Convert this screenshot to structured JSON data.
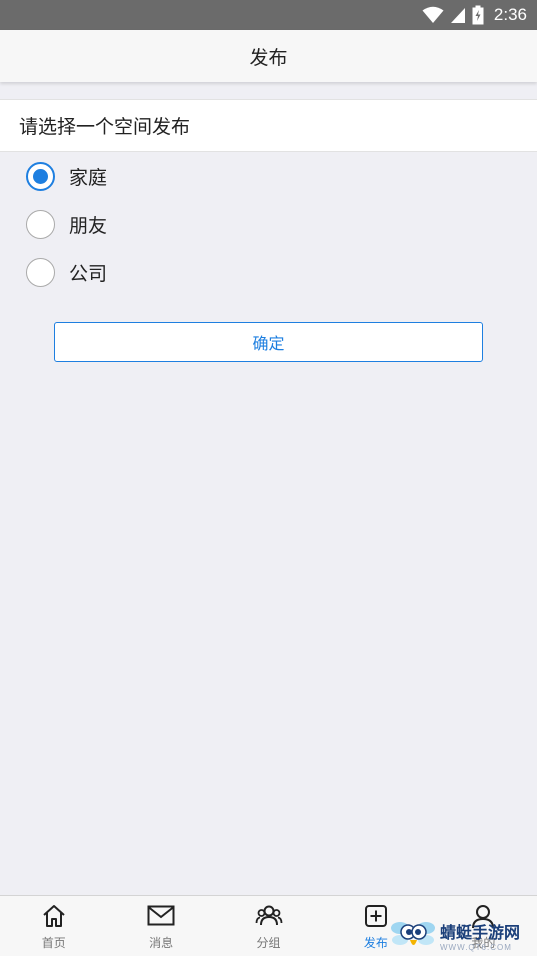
{
  "status_bar": {
    "time": "2:36"
  },
  "nav": {
    "title": "发布"
  },
  "section": {
    "header": "请选择一个空间发布"
  },
  "options": [
    {
      "label": "家庭",
      "selected": true
    },
    {
      "label": "朋友",
      "selected": false
    },
    {
      "label": "公司",
      "selected": false
    }
  ],
  "confirm_label": "确定",
  "tabs": [
    {
      "label": "首页",
      "icon": "home-icon",
      "active": false
    },
    {
      "label": "消息",
      "icon": "mail-icon",
      "active": false
    },
    {
      "label": "分组",
      "icon": "group-icon",
      "active": false
    },
    {
      "label": "发布",
      "icon": "add-square-icon",
      "active": true
    },
    {
      "label": "我的",
      "icon": "user-icon",
      "active": false
    }
  ],
  "colors": {
    "accent": "#1e7fe0",
    "background": "#efeff4",
    "status_bar": "#6b6b6b"
  },
  "watermark": {
    "main": "蜻蜓手游网",
    "sub": "WWW.QT6.COM"
  }
}
